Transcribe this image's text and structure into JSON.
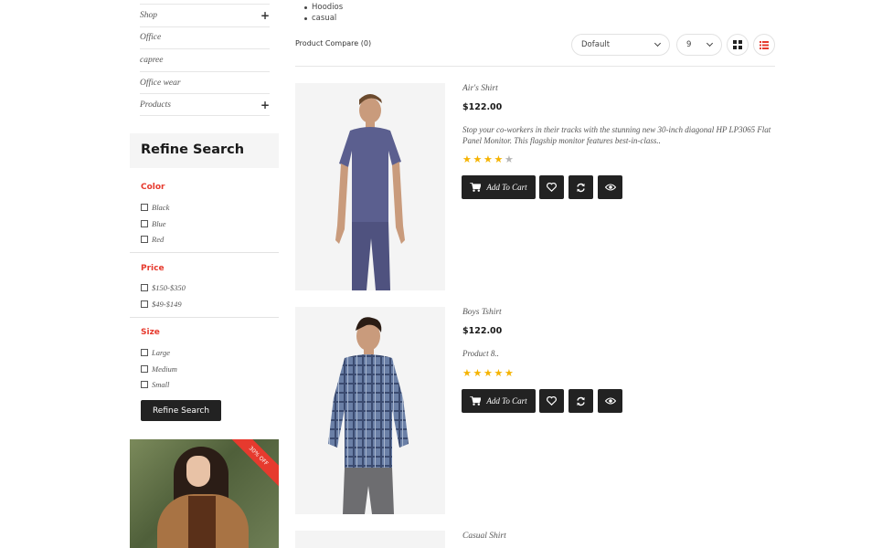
{
  "categories": [
    {
      "label": "Shop",
      "expandable": true
    },
    {
      "label": "Office",
      "expandable": false
    },
    {
      "label": "capree",
      "expandable": false
    },
    {
      "label": "Office wear",
      "expandable": false
    },
    {
      "label": "Products",
      "expandable": true
    }
  ],
  "tags": [
    "Hoodios",
    "casual"
  ],
  "refine": {
    "title": "Refine Search",
    "groups": [
      {
        "title": "Color",
        "options": [
          "Black",
          "Blue",
          "Red"
        ]
      },
      {
        "title": "Price",
        "options": [
          "$150-$350",
          "$49-$149"
        ]
      },
      {
        "title": "Size",
        "options": [
          "Large",
          "Medium",
          "Small"
        ]
      }
    ],
    "button_label": "Refine Search"
  },
  "promo": {
    "badge": "30% OFF"
  },
  "toolbar": {
    "compare_label": "Product Compare (0)",
    "sort_value": "Dofault",
    "limit_value": "9",
    "grid_icon": "grid-view-icon",
    "list_icon": "list-view-icon"
  },
  "products": [
    {
      "name": "Air's Shirt",
      "price": "$122.00",
      "description": "Stop your co-workers in their tracks with the stunning new 30-inch diagonal HP LP3065 Flat Panel Monitor. This flagship monitor features best-in-class..",
      "rating": 4,
      "cart_label": "Add To Cart"
    },
    {
      "name": "Boys Tshirt",
      "price": "$122.00",
      "description": "Product 8..",
      "rating": 5,
      "cart_label": "Add To Cart"
    },
    {
      "name": "Casual Shirt"
    }
  ],
  "colors": {
    "accent": "#e63a2e",
    "star_on": "#f5b301",
    "star_off": "#b5b5b5",
    "button": "#222222"
  }
}
